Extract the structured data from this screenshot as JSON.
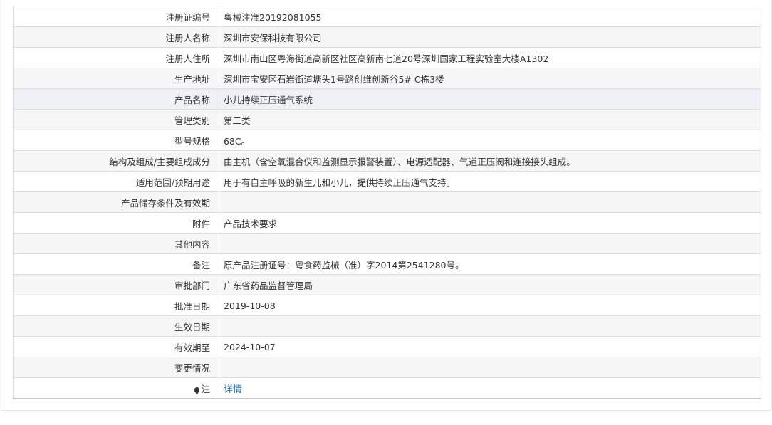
{
  "rows": [
    {
      "label": "注册证编号",
      "value": "粤械注准20192081055"
    },
    {
      "label": "注册人名称",
      "value": "深圳市安保科技有限公司"
    },
    {
      "label": "注册人住所",
      "value": "深圳市南山区粤海街道高新区社区高新南七道20号深圳国家工程实验室大楼A1302"
    },
    {
      "label": "生产地址",
      "value": "深圳市宝安区石岩街道塘头1号路创维创新谷5# C栋3楼"
    },
    {
      "label": "产品名称",
      "value": "小儿持续正压通气系统"
    },
    {
      "label": "管理类别",
      "value": "第二类"
    },
    {
      "label": "型号规格",
      "value": "68C。"
    },
    {
      "label": "结构及组成/主要组成成分",
      "value": "由主机（含空氧混合仪和监测显示报警装置）、电源适配器、气道正压阀和连接接头组成。"
    },
    {
      "label": "适用范围/预期用途",
      "value": "用于有自主呼吸的新生儿和小儿，提供持续正压通气支持。"
    },
    {
      "label": "产品储存条件及有效期",
      "value": ""
    },
    {
      "label": "附件",
      "value": "产品技术要求"
    },
    {
      "label": "其他内容",
      "value": ""
    },
    {
      "label": "备注",
      "value": "原产品注册证号：粤食药监械（准）字2014第2541280号。"
    },
    {
      "label": "审批部门",
      "value": "广东省药品监督管理局"
    },
    {
      "label": "批准日期",
      "value": "2019-10-08"
    },
    {
      "label": "生效日期",
      "value": ""
    },
    {
      "label": "有效期至",
      "value": "2024-10-07"
    },
    {
      "label": "变更情况",
      "value": ""
    }
  ],
  "note_row": {
    "label": "注",
    "icon": "lightbulb-icon",
    "link_text": "详情"
  },
  "colors": {
    "link": "#2a7ac7",
    "stripe": "#f6f6f6",
    "highlight": "#eef1f6",
    "border": "#dcdcdc"
  }
}
